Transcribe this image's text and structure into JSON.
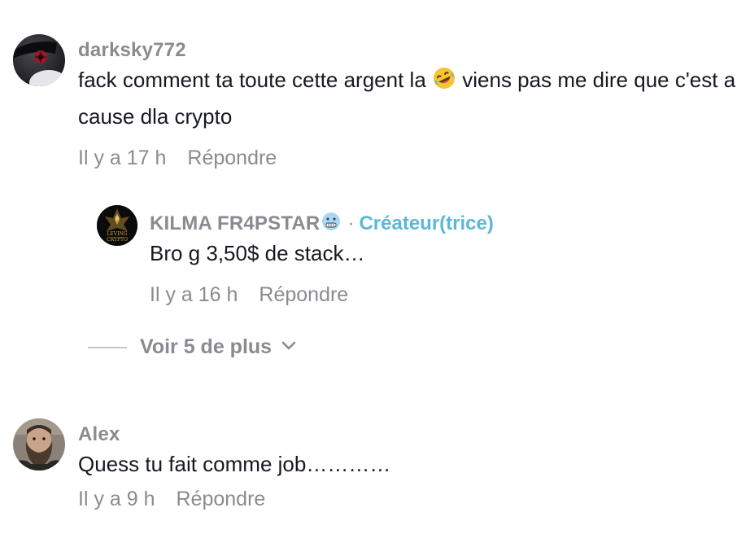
{
  "comments": [
    {
      "username": "darksky772",
      "text": "fack comment ta toute cette argent la",
      "emoji": "rolling-on-floor-laughing",
      "text_after_emoji": "viens pas me dire que c'est a cause dla crypto",
      "time": "Il y a 17 h",
      "reply_label": "Répondre"
    },
    {
      "username": "Alex",
      "text": "Quess tu fait comme job…………",
      "time": "Il y a 9 h",
      "reply_label": "Répondre"
    }
  ],
  "reply": {
    "username": "KILMA FR4PSTAR",
    "username_emoji": "cold-face",
    "separator": "·",
    "creator_badge": "Créateur(trice)",
    "avatar_text_top": "LEVING",
    "avatar_text_bottom": "CRYPTO",
    "text": "Bro g 3,50$ de stack…",
    "time": "Il y a 16 h",
    "reply_label": "Répondre"
  },
  "view_more": {
    "label": "Voir 5 de plus",
    "icon": "chevron-down-icon"
  },
  "colors": {
    "text": "#161823",
    "muted": "#8a8b91",
    "creator": "#5cb8d6"
  }
}
